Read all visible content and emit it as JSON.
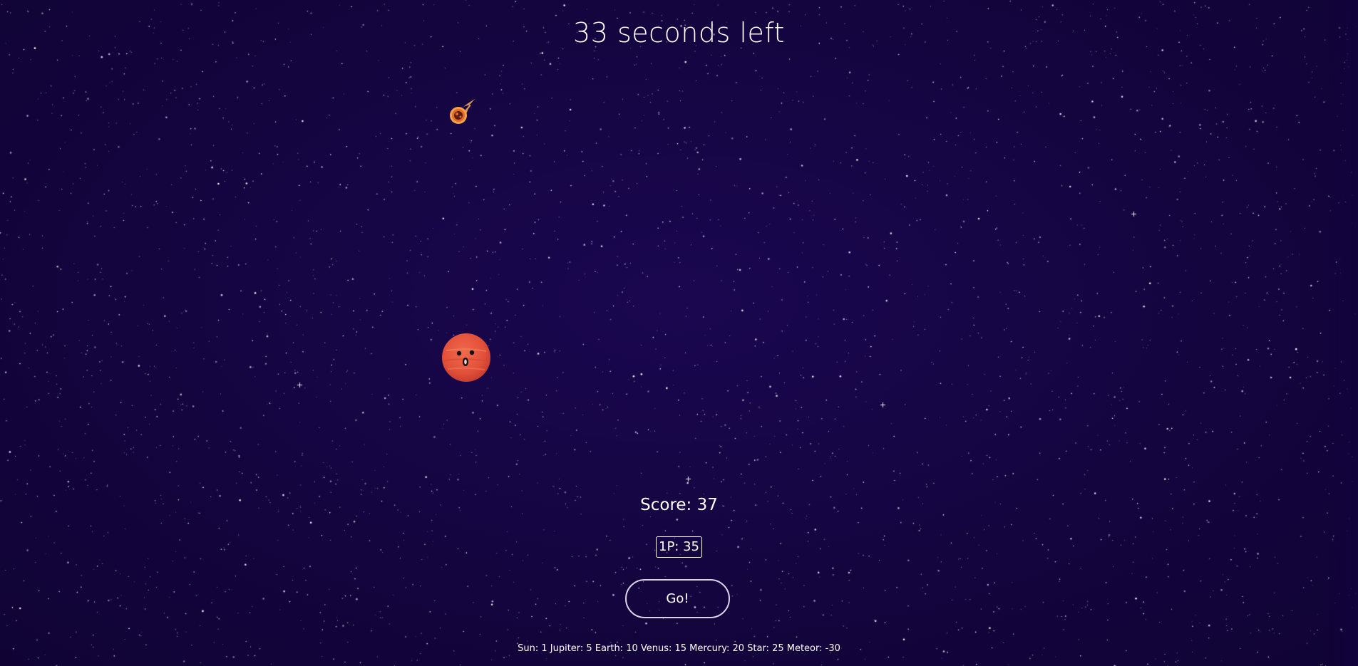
{
  "timer": {
    "text": "33 seconds left"
  },
  "score": {
    "text": "Score: 37"
  },
  "player": {
    "label": "1P: 35"
  },
  "controls": {
    "go_label": "Go!"
  },
  "legend": {
    "text": "Sun: 1 Jupiter: 5 Earth: 10 Venus: 15 Mercury: 20 Star: 25 Meteor: -30"
  },
  "sprites": {
    "planet": {
      "icon": "mars-face-icon",
      "color": "#e85a3f"
    },
    "meteor": {
      "icon": "meteor-icon",
      "color": "#f28a3a"
    }
  },
  "colors": {
    "background": "#14053f",
    "text": "#ffffff",
    "button_border": "#d9d4e6"
  }
}
